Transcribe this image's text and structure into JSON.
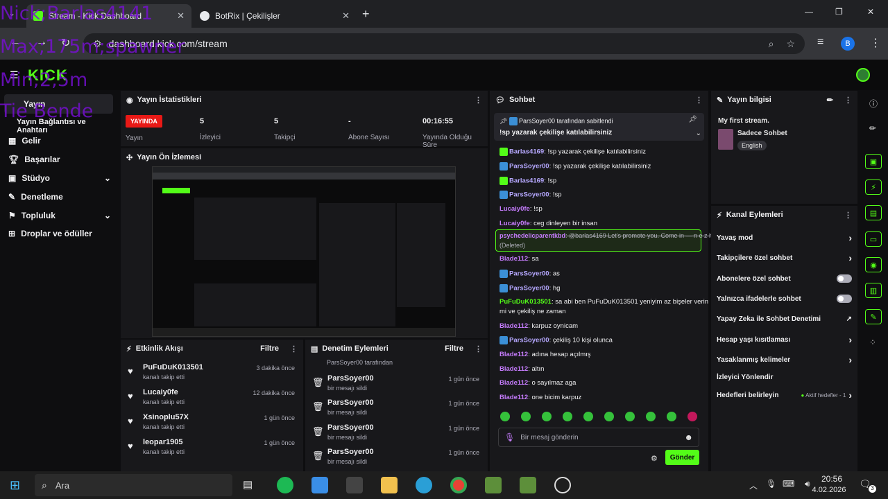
{
  "browser": {
    "tabs": [
      {
        "title": "Stream - Kick Dashboard",
        "active": true
      },
      {
        "title": "BotRix | Çekilişler",
        "active": false
      }
    ],
    "url": "dashboard.kick.com/stream",
    "profile_initial": "B"
  },
  "overlay_text": [
    "Nick;Barlas4141",
    "Max;175m;spawner",
    "Min;2,5m",
    "Tie Bende"
  ],
  "brand": {
    "logo": "KICK",
    "accent": "#53fc18"
  },
  "sidebar": {
    "items": [
      {
        "label": "Yayın",
        "icon": "broadcast-icon"
      },
      {
        "label": "Yayın Bağlantısı ve Anahtarı",
        "icon": ""
      },
      {
        "label": "Gelir",
        "icon": "revenue-icon"
      },
      {
        "label": "Başarılar",
        "icon": "trophy-icon"
      },
      {
        "label": "Stüdyo",
        "icon": "studio-icon"
      },
      {
        "label": "Denetleme",
        "icon": "wrench-icon"
      },
      {
        "label": "Topluluk",
        "icon": "community-icon"
      },
      {
        "label": "Droplar ve ödüller",
        "icon": "drops-icon"
      }
    ]
  },
  "stats": {
    "title": "Yayın İstatistikleri",
    "live_badge": "YAYINDA",
    "status_label": "Yayın",
    "items": [
      {
        "value": "5",
        "label": "İzleyici"
      },
      {
        "value": "5",
        "label": "Takipçi"
      },
      {
        "value": "-",
        "label": "Abone Sayısı"
      },
      {
        "value": "00:16:55",
        "label": "Yayında Olduğu Süre"
      }
    ]
  },
  "preview": {
    "title": "Yayın Ön İzlemesi"
  },
  "activity": {
    "title": "Etkinlik Akışı",
    "filter": "Filtre",
    "rows": [
      {
        "name": "PuFuDuK013501",
        "action": "kanalı takip etti",
        "time": "3 dakika önce"
      },
      {
        "name": "Lucaiy0fe",
        "action": "kanalı takip etti",
        "time": "12 dakika önce"
      },
      {
        "name": "Xsinoplu57X",
        "action": "kanalı takip etti",
        "time": "1 gün önce"
      },
      {
        "name": "leopar1905",
        "action": "kanalı takip etti",
        "time": "1 gün önce"
      }
    ]
  },
  "moderation": {
    "title": "Denetim Eylemleri",
    "filter": "Filtre",
    "top_line": "ParsSoyer00 tarafından",
    "rows": [
      {
        "name": "ParsSoyer00",
        "action": "bir mesajı sildi",
        "time": "1 gün önce"
      },
      {
        "name": "ParsSoyer00",
        "action": "bir mesajı sildi",
        "time": "1 gün önce"
      },
      {
        "name": "ParsSoyer00",
        "action": "bir mesajı sildi",
        "time": "1 gün önce"
      },
      {
        "name": "ParsSoyer00",
        "action": "bir mesajı sildi",
        "time": "1 gün önce"
      }
    ]
  },
  "chat": {
    "title": "Sohbet",
    "pinned_by": "ParsSoyer00 tarafından sabitlendi",
    "pinned_text": "!sp yazarak çekilişe katılabilirsiniz",
    "messages": [
      {
        "user": "Barlas4169",
        "text": ": !sp yazarak çekilişe katılabilirsiniz",
        "color": "lb",
        "badge": "mod"
      },
      {
        "user": "ParsSoyer00",
        "text": ": !sp yazarak çekilişe katılabilirsiniz",
        "color": "lb",
        "badge": "blue"
      },
      {
        "user": "Barlas4169",
        "text": ": !sp",
        "color": "lb",
        "badge": "mod"
      },
      {
        "user": "ParsSoyer00",
        "text": ": !sp",
        "color": "lb",
        "badge": "blue"
      },
      {
        "user": "Lucaiy0fe",
        "text": ": !sp",
        "color": "purple",
        "badge": ""
      },
      {
        "user": "Lucaiy0fe",
        "text": ": ceg dinleyen bir insan",
        "color": "purple",
        "badge": ""
      },
      {
        "user": "Blade112",
        "text": ": sa",
        "color": "purple",
        "badge": ""
      },
      {
        "user": "ParsSoyer00",
        "text": ": as",
        "color": "lb",
        "badge": "blue"
      },
      {
        "user": "ParsSoyer00",
        "text": ": hg",
        "color": "lb",
        "badge": "blue"
      },
      {
        "user": "PuFuDuK013501",
        "text": ": sa abi ben PuFuDuK013501 yeniyim az bişeler verin",
        "color": "green",
        "badge": ""
      },
      {
        "user": "",
        "text": "mi ve çekiliş ne zaman",
        "color": "",
        "badge": ""
      },
      {
        "user": "Blade112",
        "text": ": karpuz oynicam",
        "color": "purple",
        "badge": ""
      },
      {
        "user": "ParsSoyer00",
        "text": ": çekiliş 10 kişi olunca",
        "color": "lb",
        "badge": "blue"
      },
      {
        "user": "Blade112",
        "text": ": adına hesap açılmış",
        "color": "purple",
        "badge": ""
      },
      {
        "user": "Blade112",
        "text": ": altın",
        "color": "purple",
        "badge": ""
      },
      {
        "user": "Blade112",
        "text": ": o sayılmaz aga",
        "color": "purple",
        "badge": ""
      },
      {
        "user": "Blade112",
        "text": ": one bicim karpuz",
        "color": "purple",
        "badge": ""
      }
    ],
    "deleted": {
      "user": "psychedelicparentkbd",
      "text": ": @barlas4169 Let's promote you. Come in — n e z h n a . c o m",
      "suffix": "(Deleted)"
    },
    "input_placeholder": "Bir mesaj gönderin",
    "send_label": "Gönder"
  },
  "stream_info": {
    "title": "Yayın bilgisi",
    "stream_title": "My first stream.",
    "mode": "Sadece Sohbet",
    "language": "English"
  },
  "channel_actions": {
    "title": "Kanal Eylemleri",
    "items": [
      {
        "label": "Yavaş mod",
        "control": "chevron"
      },
      {
        "label": "Takipçilere özel sohbet",
        "control": "chevron"
      },
      {
        "label": "Abonelere özel sohbet",
        "control": "toggle"
      },
      {
        "label": "Yalnızca ifadelerle sohbet",
        "control": "toggle"
      },
      {
        "label": "Yapay Zeka ile Sohbet Denetimi",
        "control": "external"
      },
      {
        "label": "Hesap yaşı kısıtlaması",
        "control": "chevron"
      },
      {
        "label": "Yasaklanmış kelimeler",
        "control": "chevron"
      },
      {
        "label": "İzleyici Yönlendir",
        "control": "none"
      },
      {
        "label": "Hedefleri belirleyin",
        "control": "chevron",
        "extra": "Aktif hedefler - 1"
      }
    ]
  },
  "taskbar": {
    "search_placeholder": "Ara",
    "time": "20:56",
    "date": "4.02.2026",
    "notification_count": "3"
  }
}
